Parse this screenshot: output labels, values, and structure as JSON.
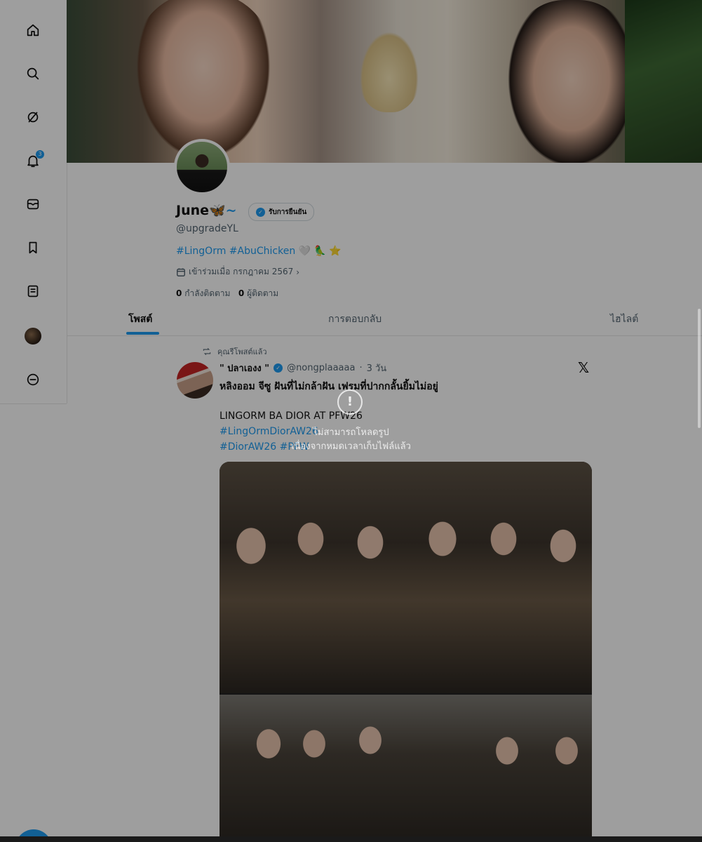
{
  "sidebar": {
    "items": [
      {
        "name": "home",
        "icon": "home-icon"
      },
      {
        "name": "search",
        "icon": "search-icon"
      },
      {
        "name": "grok",
        "icon": "grok-icon"
      },
      {
        "name": "notifications",
        "icon": "bell-icon",
        "badge": "3"
      },
      {
        "name": "messages",
        "icon": "mail-icon"
      },
      {
        "name": "bookmarks",
        "icon": "bookmark-icon"
      },
      {
        "name": "lists",
        "icon": "list-icon"
      },
      {
        "name": "profile",
        "icon": "avatar"
      },
      {
        "name": "more",
        "icon": "more-circle-icon"
      }
    ]
  },
  "profile": {
    "display_name": "June",
    "name_suffix": "🦋~",
    "subscribe_label": "รับการยืนยัน",
    "handle": "@upgradeYL",
    "bio_tags": "#LingOrm #AbuChicken",
    "bio_emoji": "🤍 🦜 ⭐",
    "joined": "เข้าร่วมเมื่อ กรกฎาคม 2567",
    "following_count": "0",
    "following_label": "กำลังติดตาม",
    "followers_count": "0",
    "followers_label": "ผู้ติดตาม"
  },
  "tabs": [
    {
      "label": "โพสต์",
      "active": true
    },
    {
      "label": "การตอบกลับ",
      "active": false
    },
    {
      "label": "ไฮไลต์",
      "active": false
    }
  ],
  "post": {
    "repost_label": "คุณรีโพสต์แล้ว",
    "author": "\" ปลาเองง \"",
    "handle": "@nongplaaaaa",
    "time": "3 วัน",
    "text_line1": "หลิงออม จีซู ฝันที่ไม่กล้าฝัน เฟรมที่ปากกลั้นยิ้มไม่อยู่",
    "text_line2": "LINGORM BA DIOR AT PFW26",
    "text_line3": "#LingOrmDiorAW26",
    "text_line4": "#DiorAW26 #PFW"
  },
  "overlay": {
    "error_icon": "!",
    "error_line1": "ไม่สามารถโหลดรูป",
    "error_line2": "เนื่องจากหมดเวลาเก็บไฟล์แล้ว"
  },
  "colors": {
    "accent": "#1d9bf0",
    "text": "#111111",
    "muted": "#536471"
  }
}
